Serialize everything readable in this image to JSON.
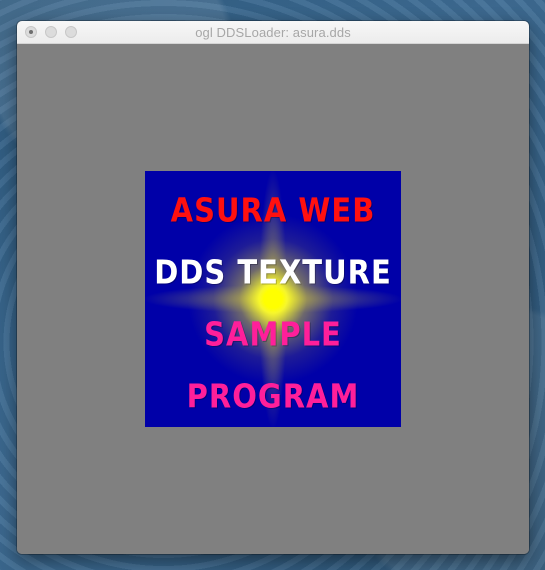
{
  "window": {
    "title": "ogl DDSLoader: asura.dds"
  },
  "texture": {
    "lines": [
      "ASURA WEB",
      "DDS TEXTURE",
      "SAMPLE",
      "PROGRAM"
    ],
    "background_color": "#0000a8",
    "glow_color": "#ffff00",
    "line_colors": [
      "#ff1010",
      "#ffffff",
      "#ff1f9a",
      "#ff1f9a"
    ]
  },
  "viewport": {
    "background_color": "#808080"
  }
}
